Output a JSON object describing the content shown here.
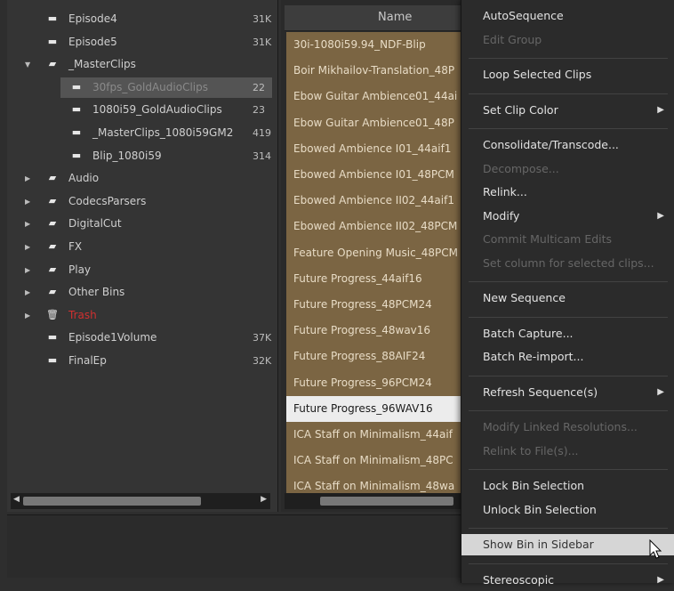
{
  "bins": [
    {
      "label": "Episode4",
      "size": "31K",
      "icon": "bin-icon",
      "triangle": ""
    },
    {
      "label": "Episode5",
      "size": "31K",
      "icon": "bin-icon",
      "triangle": ""
    },
    {
      "label": "_MasterClips",
      "size": "",
      "icon": "folder-open-icon",
      "triangle": "▼"
    },
    {
      "label": "30fps_GoldAudioClips",
      "size": "22",
      "icon": "bin-icon",
      "triangle": "",
      "selected": true
    },
    {
      "label": "1080i59_GoldAudioClips",
      "size": "23",
      "icon": "bin-icon",
      "triangle": ""
    },
    {
      "label": "_MasterClips_1080i59GM2",
      "size": "419",
      "icon": "bin-icon",
      "triangle": ""
    },
    {
      "label": "Blip_1080i59",
      "size": "314",
      "icon": "bin-icon",
      "triangle": ""
    },
    {
      "label": "Audio",
      "size": "",
      "icon": "folder-icon",
      "triangle": "▶"
    },
    {
      "label": "CodecsParsers",
      "size": "",
      "icon": "folder-icon",
      "triangle": "▶"
    },
    {
      "label": "DigitalCut",
      "size": "",
      "icon": "folder-icon",
      "triangle": "▶"
    },
    {
      "label": "FX",
      "size": "",
      "icon": "folder-icon",
      "triangle": "▶"
    },
    {
      "label": "Play",
      "size": "",
      "icon": "folder-icon",
      "triangle": "▶"
    },
    {
      "label": "Other Bins",
      "size": "",
      "icon": "folder-icon",
      "triangle": "▶"
    },
    {
      "label": "Trash",
      "size": "",
      "icon": "trash-icon",
      "triangle": "▶",
      "red": true
    },
    {
      "label": "Episode1Volume",
      "size": "37K",
      "icon": "bin-icon",
      "triangle": ""
    },
    {
      "label": "FinalEp",
      "size": "32K",
      "icon": "bin-icon",
      "triangle": ""
    }
  ],
  "clips": {
    "header": "Name",
    "rows": [
      "30i-1080i59.94_NDF-Blip",
      "Boir Mikhailov-Translation_48P",
      "Ebow Guitar Ambience01_44ai",
      "Ebow Guitar Ambience01_48P",
      "Ebowed Ambience I01_44aif1",
      "Ebowed Ambience I01_48PCM",
      "Ebowed Ambience II02_44aif1",
      "Ebowed Ambience II02_48PCM",
      "Feature Opening Music_48PCM",
      "Future Progress_44aif16",
      "Future Progress_48PCM24",
      "Future Progress_48wav16",
      "Future Progress_88AIF24",
      "Future Progress_96PCM24",
      "Future Progress_96WAV16",
      "ICA Staff on Minimalism_44aif",
      "ICA Staff on Minimalism_48PC",
      "ICA Staff on Minimalism_48wa"
    ],
    "selected_index": 14
  },
  "menu": [
    {
      "label": "AutoSequence",
      "disabled": false
    },
    {
      "label": "Edit Group",
      "disabled": true
    },
    {
      "sep": true
    },
    {
      "label": "Loop Selected Clips",
      "disabled": false
    },
    {
      "sep": true
    },
    {
      "label": "Set Clip Color",
      "disabled": false,
      "submenu": true
    },
    {
      "sep": true
    },
    {
      "label": "Consolidate/Transcode...",
      "disabled": false
    },
    {
      "label": "Decompose...",
      "disabled": true
    },
    {
      "label": "Relink...",
      "disabled": false
    },
    {
      "label": "Modify",
      "disabled": false,
      "submenu": true
    },
    {
      "label": "Commit Multicam Edits",
      "disabled": true
    },
    {
      "label": "Set column for selected clips...",
      "disabled": true
    },
    {
      "sep": true
    },
    {
      "label": "New Sequence",
      "disabled": false
    },
    {
      "sep": true
    },
    {
      "label": "Batch Capture...",
      "disabled": false
    },
    {
      "label": "Batch Re-import...",
      "disabled": false
    },
    {
      "sep": true
    },
    {
      "label": "Refresh Sequence(s)",
      "disabled": false,
      "submenu": true
    },
    {
      "sep": true
    },
    {
      "label": "Modify Linked Resolutions...",
      "disabled": true
    },
    {
      "label": "Relink to File(s)...",
      "disabled": true
    },
    {
      "sep": true
    },
    {
      "label": "Lock Bin Selection",
      "disabled": false
    },
    {
      "label": "Unlock Bin Selection",
      "disabled": false
    },
    {
      "sep": true
    },
    {
      "label": "Show Bin in Sidebar",
      "disabled": false,
      "highlighted": true
    },
    {
      "sep": true
    },
    {
      "label": "Stereoscopic",
      "disabled": false,
      "submenu": true
    }
  ],
  "colors": {
    "clip_bg": "#7b6543",
    "highlight": "#d6d6d6",
    "trash": "#d03030"
  }
}
